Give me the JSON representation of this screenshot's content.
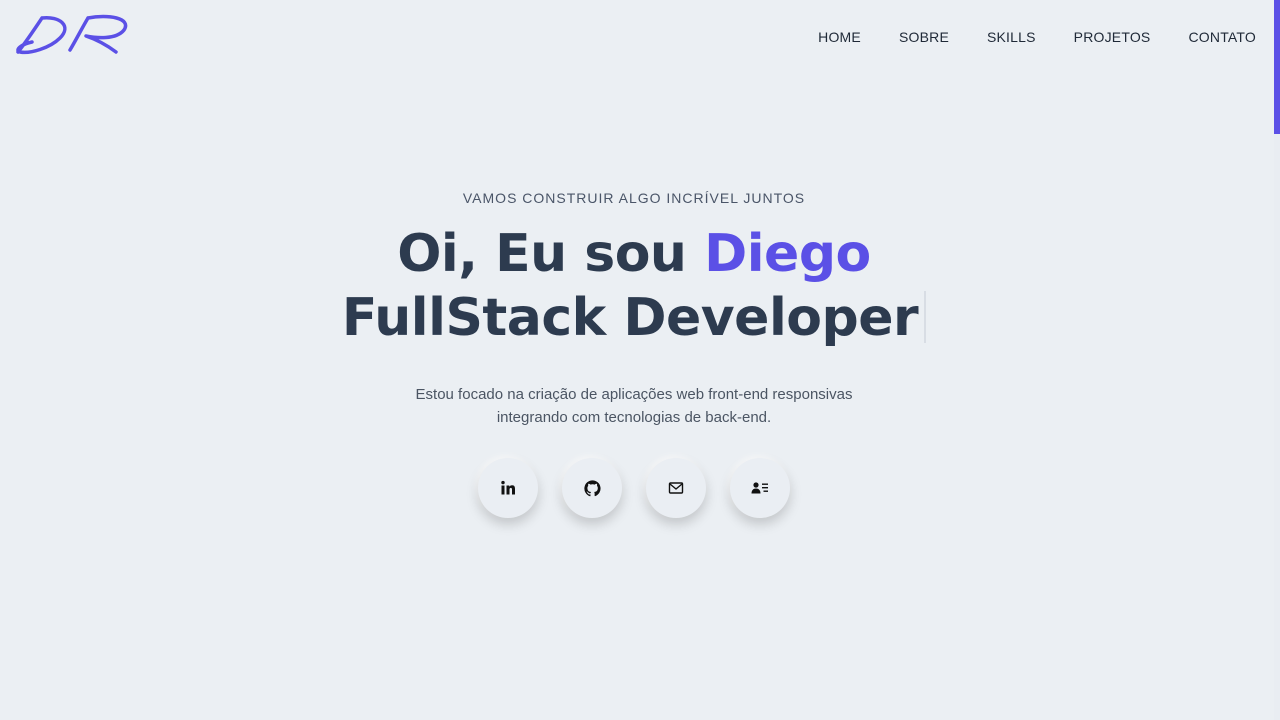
{
  "nav": {
    "items": [
      {
        "label": "HOME"
      },
      {
        "label": "SOBRE"
      },
      {
        "label": "SKILLS"
      },
      {
        "label": "PROJETOS"
      },
      {
        "label": "CONTATO"
      }
    ]
  },
  "hero": {
    "eyebrow": "VAMOS CONSTRUIR ALGO INCRÍVEL JUNTOS",
    "greeting_prefix": "Oi, Eu sou ",
    "name": "Diego",
    "role": "FullStack Developer",
    "description_line1": "Estou focado na criação de aplicações web front-end responsivas",
    "description_line2": "integrando com tecnologias de back-end."
  },
  "socials": [
    {
      "icon": "linkedin-icon"
    },
    {
      "icon": "github-icon"
    },
    {
      "icon": "mail-icon"
    },
    {
      "icon": "contact-card-icon"
    }
  ],
  "colors": {
    "accent": "#5b50e6",
    "background": "#ebeff3",
    "text": "#2d3b4f"
  }
}
